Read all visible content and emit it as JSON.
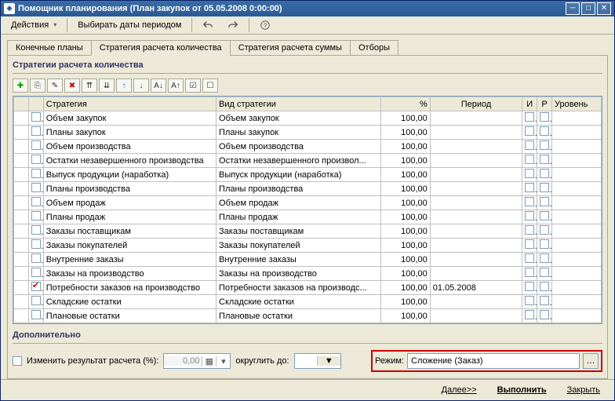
{
  "window": {
    "title": "Помощник планирования (План закупок  от 05.05.2008 0:00:00)"
  },
  "toolbar": {
    "actions": "Действия",
    "pickDates": "Выбирать даты периодом"
  },
  "tabs": [
    "Конечные планы",
    "Стратегия расчета количества",
    "Стратегия расчета суммы",
    "Отборы"
  ],
  "activeTab": 1,
  "groupTitle": "Стратегии расчета количества",
  "columns": {
    "strategy": "Стратегия",
    "type": "Вид стратегии",
    "pct": "%",
    "period": "Период",
    "i": "И",
    "p": "Р",
    "level": "Уровень"
  },
  "rows": [
    {
      "chk": false,
      "strategy": "Объем закупок",
      "type": "Объем закупок",
      "pct": "100,00",
      "period": "",
      "hl": false
    },
    {
      "chk": false,
      "strategy": "Планы закупок",
      "type": "Планы закупок",
      "pct": "100,00",
      "period": "",
      "hl": false
    },
    {
      "chk": false,
      "strategy": "Объем производства",
      "type": "Объем производства",
      "pct": "100,00",
      "period": "",
      "hl": false
    },
    {
      "chk": false,
      "strategy": "Остатки незавершенного производства",
      "type": "Остатки незавершенного произвол...",
      "pct": "100,00",
      "period": "",
      "hl": false
    },
    {
      "chk": false,
      "strategy": "Выпуск продукции (наработка)",
      "type": "Выпуск продукции (наработка)",
      "pct": "100,00",
      "period": "",
      "hl": false
    },
    {
      "chk": false,
      "strategy": "Планы производства",
      "type": "Планы производства",
      "pct": "100,00",
      "period": "",
      "hl": false
    },
    {
      "chk": false,
      "strategy": "Объем продаж",
      "type": "Объем продаж",
      "pct": "100,00",
      "period": "",
      "hl": false
    },
    {
      "chk": false,
      "strategy": "Планы продаж",
      "type": "Планы продаж",
      "pct": "100,00",
      "period": "",
      "hl": false
    },
    {
      "chk": false,
      "strategy": "Заказы поставщикам",
      "type": "Заказы поставщикам",
      "pct": "100,00",
      "period": "",
      "hl": false
    },
    {
      "chk": false,
      "strategy": "Заказы покупателей",
      "type": "Заказы покупателей",
      "pct": "100,00",
      "period": "",
      "hl": false
    },
    {
      "chk": false,
      "strategy": "Внутренние заказы",
      "type": "Внутренние заказы",
      "pct": "100,00",
      "period": "",
      "hl": false
    },
    {
      "chk": false,
      "strategy": "Заказы на производство",
      "type": "Заказы на производство",
      "pct": "100,00",
      "period": "",
      "hl": false
    },
    {
      "chk": true,
      "strategy": "Потребности заказов на производство",
      "type": "Потребности заказов на производс...",
      "pct": "100,00",
      "period": "01.05.2008",
      "hl": true
    },
    {
      "chk": false,
      "strategy": "Складские остатки",
      "type": "Складские остатки",
      "pct": "100,00",
      "period": "",
      "hl": false
    },
    {
      "chk": false,
      "strategy": "Плановые остатки",
      "type": "Плановые остатки",
      "pct": "100,00",
      "period": "",
      "hl": false
    }
  ],
  "bottom": {
    "title": "Дополнительно",
    "changeResult": "Изменить результат расчета (%):",
    "changeVal": "0,00",
    "roundTo": "округлить до:",
    "roundVal": "",
    "modeLabel": "Режим:",
    "modeVal": "Сложение (Заказ)"
  },
  "footer": {
    "next": "Далее>>",
    "run": "Выполнить",
    "close": "Закрыть"
  }
}
